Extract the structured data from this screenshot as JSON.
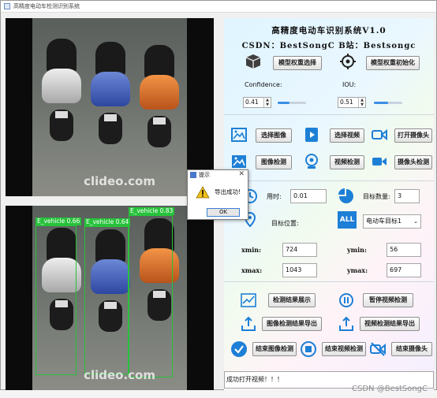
{
  "window": {
    "title": "高精度电动车检测识别系统"
  },
  "header": {
    "title": "高精度电动车识别系统V1.0",
    "credit": "CSDN：BestSongC  B站：Bestsongc"
  },
  "model": {
    "select_label": "模型权重选择",
    "init_label": "模型权重初始化",
    "confidence_label": "Confidence:",
    "confidence_value": "0.41",
    "confidence_level": 0.41,
    "iou_label": "IOU:",
    "iou_value": "0.51",
    "iou_level": 0.51
  },
  "actions": {
    "select_image": "选择图像",
    "select_video": "选择视频",
    "open_camera": "打开摄像头",
    "image_detect": "图像检测",
    "video_detect": "视频检测",
    "camera_detect": "摄像头检测"
  },
  "results": {
    "time_label": "用时:",
    "time_value": "0.01",
    "count_label": "目标数量:",
    "count_value": "3",
    "position_label": "目标位置:",
    "target_select": "电动车目标1",
    "xmin_label": "xmin:",
    "xmin_value": "724",
    "ymin_label": "ymin:",
    "ymin_value": "56",
    "xmax_label": "xmax:",
    "xmax_value": "1043",
    "ymax_label": "ymax:",
    "ymax_value": "697"
  },
  "controls": {
    "show_results": "检测结果展示",
    "pause_video": "暂停视频检测",
    "export_image": "图像检测结果导出",
    "export_video": "视频检测结果导出",
    "end_image": "结束图像检测",
    "end_video": "结束视频检测",
    "end_camera": "结束摄像头"
  },
  "status_text": "成功打开视频！！！",
  "image": {
    "watermark": "clideo.com",
    "detections": [
      "E_vehicle  0.66",
      "E_vehicle  0.64",
      "E_vehicle  0.83"
    ]
  },
  "dialog": {
    "title": "提示",
    "message": "导出成功!",
    "ok": "OK"
  },
  "footer": {
    "watermark": "CSDN @BestSongC"
  },
  "colors": {
    "accent": "#3b8ee6",
    "box": "#27c23a"
  }
}
